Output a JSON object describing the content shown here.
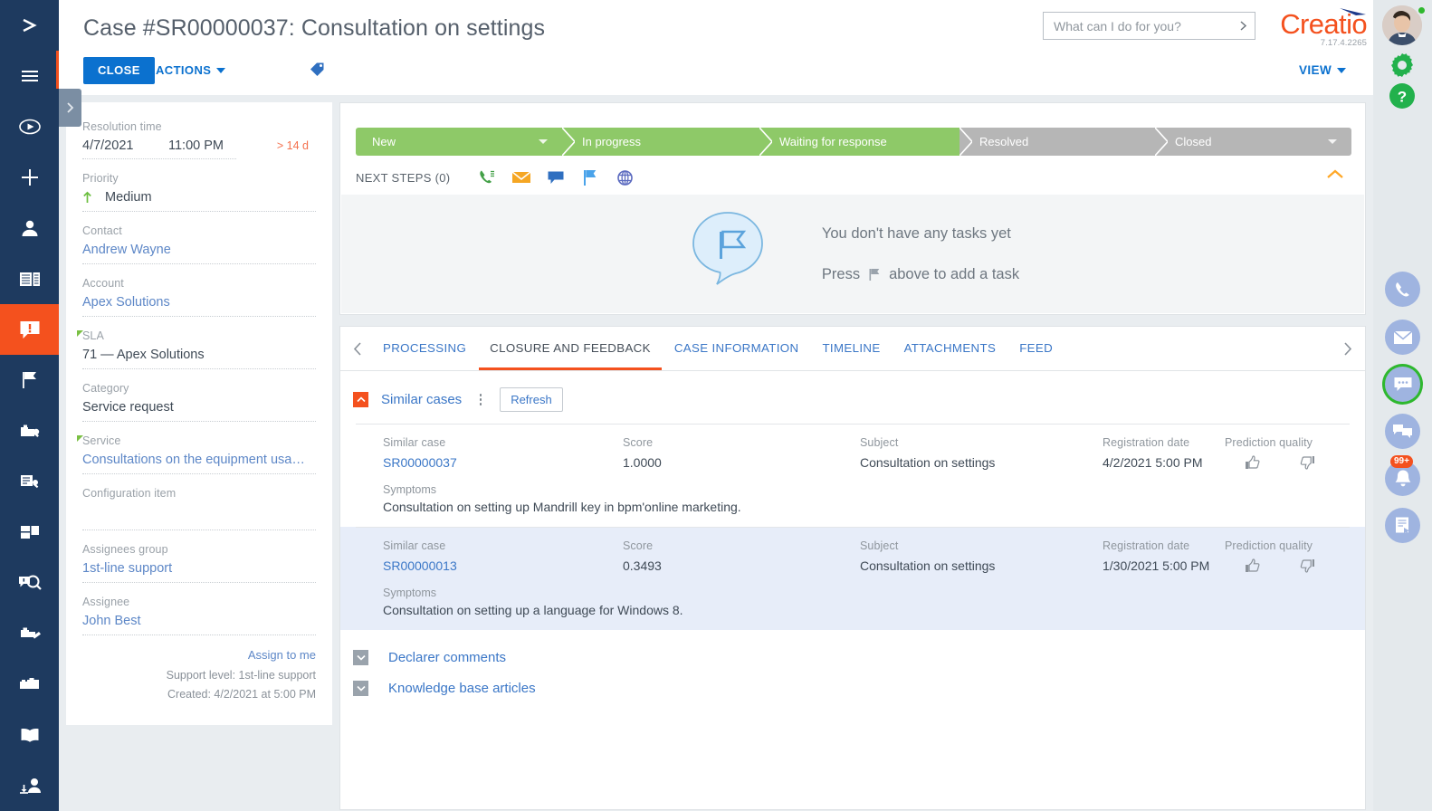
{
  "header": {
    "title": "Case #SR00000037: Consultation on settings",
    "close_label": "CLOSE",
    "actions_label": "ACTIONS",
    "view_label": "VIEW",
    "brand": "Creatio",
    "version": "7.17.4.2265"
  },
  "search": {
    "placeholder": "What can I do for you?",
    "value": ""
  },
  "left_nav": {
    "items": [
      {
        "name": "expand-menu-icon",
        "label": "Expand menu"
      },
      {
        "name": "hamburger-menu-icon",
        "label": "Main menu"
      },
      {
        "name": "run-process-icon",
        "label": "Run process"
      },
      {
        "name": "add-icon",
        "label": "Add"
      },
      {
        "name": "contacts-icon",
        "label": "Contacts"
      },
      {
        "name": "accounts-icon",
        "label": "Accounts"
      },
      {
        "name": "cases-icon",
        "label": "Cases"
      },
      {
        "name": "flag-icon",
        "label": "Activities"
      },
      {
        "name": "service-catalog-icon",
        "label": "Service catalog"
      },
      {
        "name": "service-requests-icon",
        "label": "Service requests"
      },
      {
        "name": "dashboards-icon",
        "label": "Dashboards"
      },
      {
        "name": "case-search-icon",
        "label": "Case search"
      },
      {
        "name": "configuration-icon",
        "label": "Configuration"
      },
      {
        "name": "projects-icon",
        "label": "Projects"
      },
      {
        "name": "knowledge-base-icon",
        "label": "Knowledge base"
      },
      {
        "name": "agent-desktop-icon",
        "label": "Agent desktop"
      }
    ],
    "active_index": 6
  },
  "info_panel": {
    "resolution_time": {
      "label": "Resolution time",
      "date": "4/7/2021",
      "time": "11:00 PM",
      "overdue": "> 14 d",
      "overdue_color": "#f4714e"
    },
    "priority": {
      "label": "Priority",
      "value": "Medium",
      "arrow_color": "#6cbf3f"
    },
    "contact": {
      "label": "Contact",
      "value": "Andrew Wayne"
    },
    "account": {
      "label": "Account",
      "value": "Apex Solutions"
    },
    "sla": {
      "label": "SLA",
      "value": "71 — Apex Solutions",
      "required": true
    },
    "category": {
      "label": "Category",
      "value": "Service request"
    },
    "service": {
      "label": "Service",
      "value": "Consultations on the equipment usa…",
      "required": true
    },
    "configuration_item": {
      "label": "Configuration item",
      "value": ""
    },
    "assignees_group": {
      "label": "Assignees group",
      "value": "1st-line support"
    },
    "assignee": {
      "label": "Assignee",
      "value": "John Best"
    },
    "assign_to_me": "Assign to me",
    "support_level": "Support level: 1st-line support",
    "created": "Created: 4/2/2021 at 5:00 PM"
  },
  "stages": [
    {
      "label": "New",
      "state": "active",
      "has_caret": true
    },
    {
      "label": "In progress",
      "state": "active",
      "has_caret": false
    },
    {
      "label": "Waiting for response",
      "state": "active",
      "has_caret": false
    },
    {
      "label": "Resolved",
      "state": "inactive",
      "has_caret": false
    },
    {
      "label": "Closed",
      "state": "inactive",
      "has_caret": true
    }
  ],
  "stage_colors": {
    "active": "#8ec968",
    "inactive": "#b6b6b6"
  },
  "next_steps": {
    "label": "NEXT STEPS (0)",
    "icons": [
      {
        "name": "call-icon",
        "color": "#43a047"
      },
      {
        "name": "email-icon",
        "color": "#f5a623"
      },
      {
        "name": "message-icon",
        "color": "#2f6fc0"
      },
      {
        "name": "flag-icon",
        "color": "#4aa3ea"
      },
      {
        "name": "web-icon",
        "color": "#5c6bc0"
      }
    ],
    "empty_title": "You don't have any tasks yet",
    "empty_hint_before": "Press",
    "empty_hint_after": "above to add a task"
  },
  "tabs": {
    "items": [
      {
        "label": "PROCESSING",
        "active": false
      },
      {
        "label": "CLOSURE AND FEEDBACK",
        "active": true
      },
      {
        "label": "CASE INFORMATION",
        "active": false
      },
      {
        "label": "TIMELINE",
        "active": false
      },
      {
        "label": "ATTACHMENTS",
        "active": false
      },
      {
        "label": "FEED",
        "active": false
      }
    ],
    "accent_color": "#f4511e"
  },
  "similar_cases": {
    "title": "Similar cases",
    "refresh_label": "Refresh",
    "columns": [
      "Similar case",
      "Score",
      "Subject",
      "Registration date",
      "Prediction quality"
    ],
    "symptoms_label": "Symptoms",
    "rows": [
      {
        "similar_case": "SR00000037",
        "score": "1.0000",
        "subject": "Consultation on settings",
        "registration_date": "4/2/2021 5:00 PM",
        "symptoms": "Consultation on setting up Mandrill key in bpm'online marketing.",
        "highlighted": false
      },
      {
        "similar_case": "SR00000013",
        "score": "0.3493",
        "subject": "Consultation on settings",
        "registration_date": "1/30/2021 5:00 PM",
        "symptoms": "Consultation on setting up a language for Windows 8.",
        "highlighted": true
      }
    ]
  },
  "sub_sections": [
    {
      "title": "Declarer comments"
    },
    {
      "title": "Knowledge base articles"
    }
  ],
  "right_rail": {
    "gear_label": "Settings",
    "help_label": "Help",
    "comm_items": [
      {
        "name": "phone-icon",
        "badge": ""
      },
      {
        "name": "email-icon",
        "badge": ""
      },
      {
        "name": "chat-icon",
        "badge": ""
      },
      {
        "name": "conversations-icon",
        "badge": ""
      },
      {
        "name": "notifications-icon",
        "badge": "99+"
      },
      {
        "name": "feed-icon",
        "badge": ""
      }
    ]
  }
}
